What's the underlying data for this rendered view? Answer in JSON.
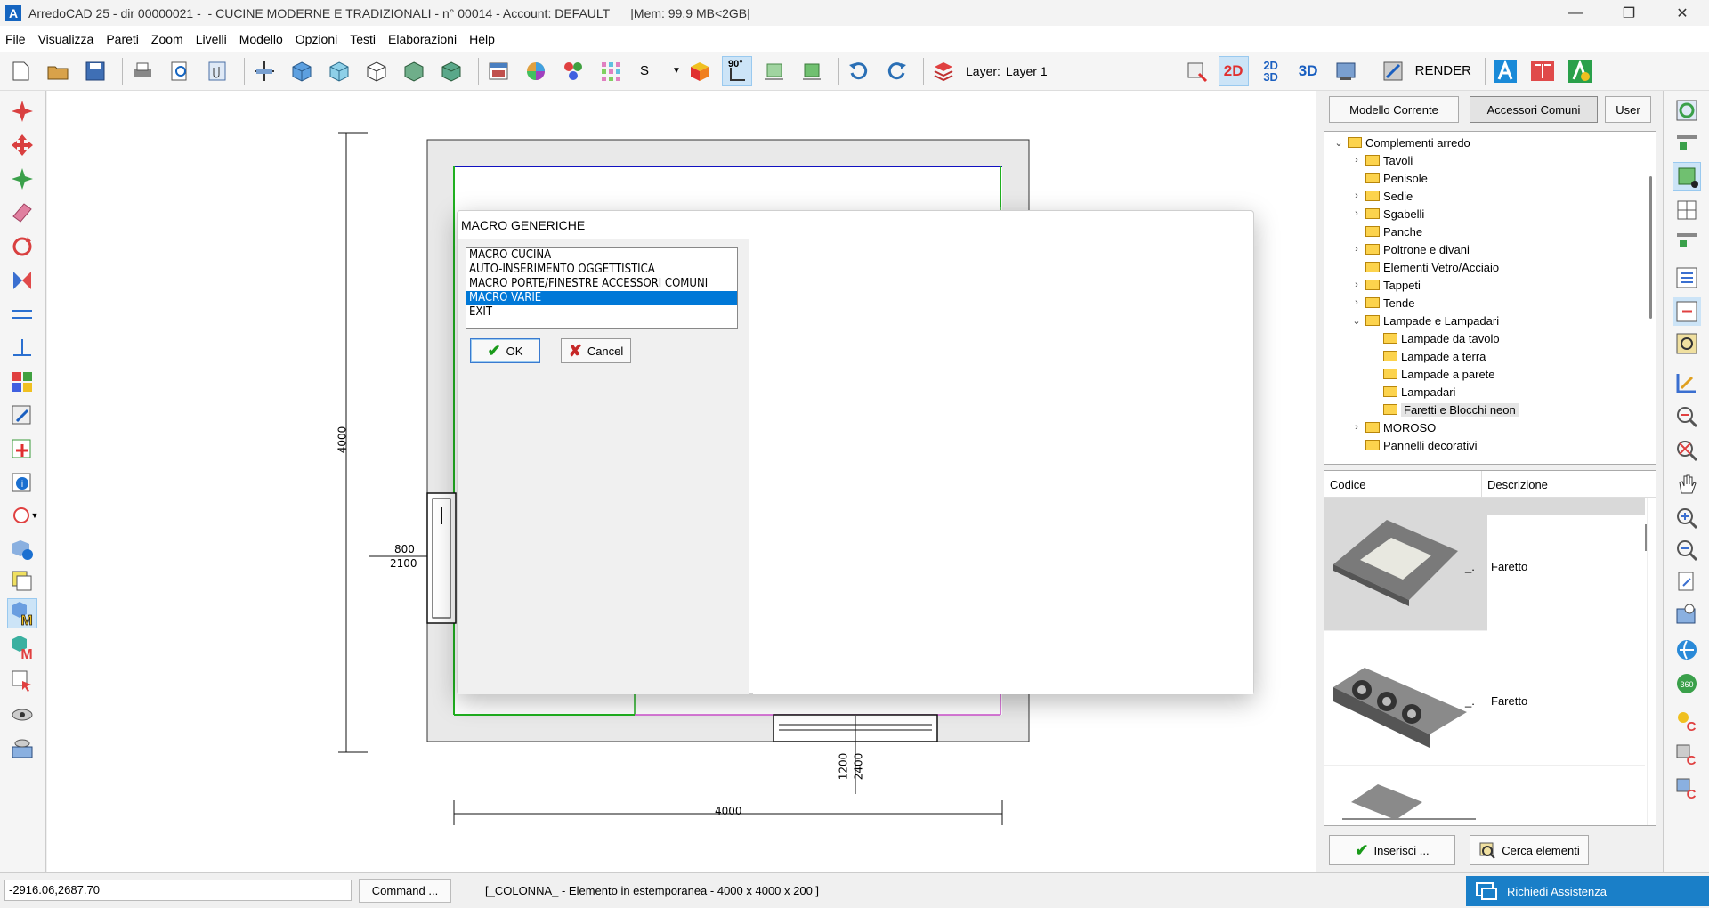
{
  "window": {
    "title": "ArredoCAD 25 - dir 00000021 -  - CUCINE MODERNE E TRADIZIONALI - n° 00014 - Account: DEFAULT      |Mem: 99.9 MB<2GB|",
    "logo_letter": "A"
  },
  "menu": [
    "File",
    "Visualizza",
    "Pareti",
    "Zoom",
    "Livelli",
    "Modello",
    "Opzioni",
    "Testi",
    "Elaborazioni",
    "Help"
  ],
  "toolbar": {
    "s_label": "S",
    "angle_label": "90°",
    "layer_label": "Layer:",
    "layer_value": "Layer 1",
    "view_2d": "2D",
    "view_2d3d_top": "2D",
    "view_2d3d_bottom": "3D",
    "view_3d": "3D",
    "render_label": "RENDER"
  },
  "drawing": {
    "dim_left": "4000",
    "door_top": "800",
    "door_bottom": "2100",
    "dim_bottom": "4000",
    "win_dim_1": "1200",
    "win_dim_2": "2400"
  },
  "dialog": {
    "title": "MACRO GENERICHE",
    "items": [
      "MACRO CUCINA",
      "AUTO-INSERIMENTO OGGETTISTICA",
      "MACRO PORTE/FINESTRE ACCESSORI COMUNI",
      "MACRO VARIE",
      "EXIT"
    ],
    "selected_index": 3,
    "ok_label": "OK",
    "cancel_label": "Cancel"
  },
  "right_panel": {
    "tabs": [
      "Modello Corrente",
      "Accessori Comuni",
      "User"
    ],
    "active_tab": 1,
    "tree": [
      {
        "label": "Complementi arredo",
        "level": 0,
        "chev": "v",
        "open": true
      },
      {
        "label": "Tavoli",
        "level": 1,
        "chev": ">"
      },
      {
        "label": "Penisole",
        "level": 1,
        "chev": ""
      },
      {
        "label": "Sedie",
        "level": 1,
        "chev": ">"
      },
      {
        "label": "Sgabelli",
        "level": 1,
        "chev": ">"
      },
      {
        "label": "Panche",
        "level": 1,
        "chev": ""
      },
      {
        "label": "Poltrone e divani",
        "level": 1,
        "chev": ">"
      },
      {
        "label": "Elementi Vetro/Acciaio",
        "level": 1,
        "chev": ""
      },
      {
        "label": "Tappeti",
        "level": 1,
        "chev": ">"
      },
      {
        "label": "Tende",
        "level": 1,
        "chev": ">"
      },
      {
        "label": "Lampade e Lampadari",
        "level": 1,
        "chev": "v",
        "open": true
      },
      {
        "label": "Lampade da tavolo",
        "level": 2,
        "chev": ""
      },
      {
        "label": "Lampade a terra",
        "level": 2,
        "chev": ""
      },
      {
        "label": "Lampade a parete",
        "level": 2,
        "chev": ""
      },
      {
        "label": "Lampadari",
        "level": 2,
        "chev": ""
      },
      {
        "label": "Faretti e Blocchi neon",
        "level": 2,
        "chev": "",
        "selected": true
      },
      {
        "label": "MOROSO",
        "level": 1,
        "chev": ">"
      },
      {
        "label": "Pannelli decorativi",
        "level": 1,
        "chev": ""
      }
    ],
    "grid_headers": [
      "Codice",
      "Descrizione"
    ],
    "grid_rows": [
      {
        "code": "_.",
        "desc": "Faretto"
      },
      {
        "code": "_.",
        "desc": "Faretto"
      }
    ],
    "insert_label": "Inserisci ...",
    "search_label": "Cerca elementi"
  },
  "status": {
    "coords": "-2916.06,2687.70",
    "command_label": "Command ...",
    "message": "[_COLONNA_ - Elemento in estemporanea - 4000 x 4000 x 200 ]",
    "assist_label": "Richiedi Assistenza"
  },
  "colors": {
    "accent": "#0078d7",
    "assist_bg": "#1a7fc8",
    "wall": "#e9e9e9",
    "green_line": "#20b020",
    "blue_line": "#1010c0",
    "magenta_line": "#d050d0"
  }
}
